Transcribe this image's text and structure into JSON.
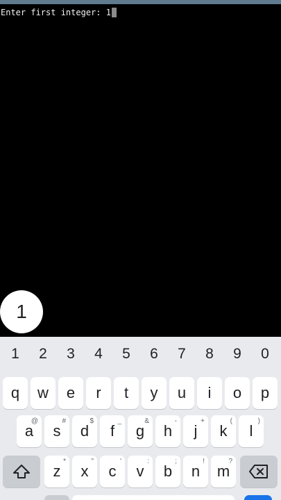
{
  "terminal": {
    "prompt": "Enter first integer: ",
    "input_value": "1"
  },
  "keyboard": {
    "preview_char": "1",
    "number_row": [
      "1",
      "2",
      "3",
      "4",
      "5",
      "6",
      "7",
      "8",
      "9",
      "0"
    ],
    "row1": [
      {
        "label": "q"
      },
      {
        "label": "w"
      },
      {
        "label": "e"
      },
      {
        "label": "r"
      },
      {
        "label": "t"
      },
      {
        "label": "y"
      },
      {
        "label": "u"
      },
      {
        "label": "i"
      },
      {
        "label": "o"
      },
      {
        "label": "p"
      }
    ],
    "row2": [
      {
        "label": "a",
        "hint": "@"
      },
      {
        "label": "s",
        "hint": "#"
      },
      {
        "label": "d",
        "hint": "$"
      },
      {
        "label": "f",
        "hint": "_"
      },
      {
        "label": "g",
        "hint": "&"
      },
      {
        "label": "h",
        "hint": "-"
      },
      {
        "label": "j",
        "hint": "+"
      },
      {
        "label": "k",
        "hint": "("
      },
      {
        "label": "l",
        "hint": ")"
      }
    ],
    "row3": [
      {
        "label": "z",
        "hint": "*"
      },
      {
        "label": "x",
        "hint": "\""
      },
      {
        "label": "c",
        "hint": "'"
      },
      {
        "label": "v",
        "hint": ":"
      },
      {
        "label": "b",
        "hint": ";"
      },
      {
        "label": "n",
        "hint": "!"
      },
      {
        "label": "m",
        "hint": "?"
      }
    ],
    "shift_icon": "shift-icon",
    "delete_icon": "backspace-icon"
  },
  "colors": {
    "status_bar": "#5f7b8e",
    "terminal_bg": "#000000",
    "keyboard_bg": "#e8eaed",
    "key_bg": "#ffffff",
    "special_key_bg": "#c9ccd1",
    "accent": "#1a73e8"
  }
}
